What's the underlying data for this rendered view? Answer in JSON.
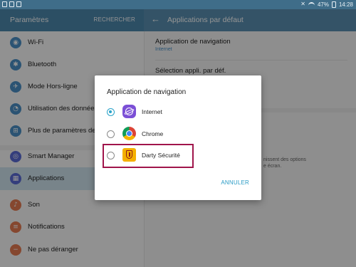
{
  "status_bar": {
    "battery": "47%",
    "time": "14:28"
  },
  "left_header": {
    "title": "Paramètres",
    "search": "RECHERCHER"
  },
  "right_header": {
    "back_glyph": "←",
    "title": "Applications par défaut"
  },
  "sidebar": {
    "items": [
      {
        "label": "Wi-Fi",
        "icon": "wifi-icon",
        "glyph": "◉",
        "color": "#4a90c6",
        "selected": false
      },
      {
        "label": "Bluetooth",
        "icon": "bluetooth-icon",
        "glyph": "✱",
        "color": "#4a90c6",
        "selected": false
      },
      {
        "label": "Mode Hors-ligne",
        "icon": "airplane-icon",
        "glyph": "✈",
        "color": "#4a90c6",
        "selected": false
      },
      {
        "label": "Utilisation des données",
        "icon": "data-usage-icon",
        "glyph": "◔",
        "color": "#4a90c6",
        "selected": false
      },
      {
        "label": "Plus de paramètres de c",
        "icon": "more-connections-icon",
        "glyph": "⊞",
        "color": "#4a90c6",
        "selected": false
      },
      {
        "label": "Smart Manager",
        "icon": "smart-manager-icon",
        "glyph": "◎",
        "color": "#5a6bd6",
        "selected": false
      },
      {
        "label": "Applications",
        "icon": "applications-icon",
        "glyph": "▦",
        "color": "#5a6bd6",
        "selected": true
      },
      {
        "label": "Son",
        "icon": "sound-icon",
        "glyph": "♪",
        "color": "#e57b52",
        "selected": false
      },
      {
        "label": "Notifications",
        "icon": "notifications-icon",
        "glyph": "≡",
        "color": "#e57b52",
        "selected": false
      },
      {
        "label": "Ne pas déranger",
        "icon": "do-not-disturb-icon",
        "glyph": "−",
        "color": "#e57b52",
        "selected": false
      }
    ]
  },
  "right_panel": {
    "nav_app_title": "Application de navigation",
    "nav_app_value": "Internet",
    "select_app_title": "Sélection appli. par déf.",
    "desc_line1": "nissent des options",
    "desc_line2": "e écran."
  },
  "dialog": {
    "title": "Application de navigation",
    "options": [
      {
        "label": "Internet",
        "icon": "samsung-internet-icon",
        "checked": true
      },
      {
        "label": "Chrome",
        "icon": "chrome-icon",
        "checked": false
      },
      {
        "label": "Darty Sécurité",
        "icon": "darty-securite-icon",
        "checked": false
      }
    ],
    "cancel": "ANNULER"
  }
}
